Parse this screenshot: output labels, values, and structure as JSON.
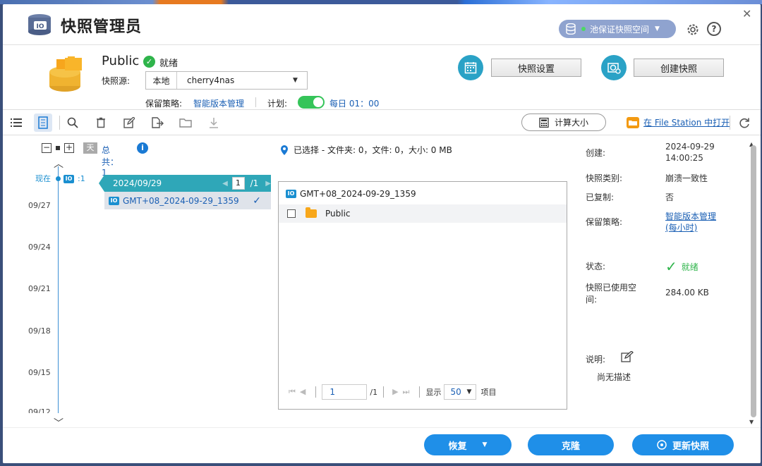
{
  "app": {
    "title": "快照管理员",
    "pool_button": "池保证快照空间",
    "help": "?"
  },
  "header": {
    "share_name": "Public",
    "status": "就绪",
    "source_label": "快照源:",
    "source_location": "本地",
    "source_host": "cherry4nas",
    "retention_label": "保留策略:",
    "retention_value": "智能版本管理",
    "plan_label": "计划:",
    "plan_value": "每日 01：00",
    "plan_enabled": true,
    "snapshot_settings_button": "快照设置",
    "create_snapshot_button": "创建快照"
  },
  "toolbar": {
    "calc_size_button": "计算大小",
    "open_in_fs_link": "在 File Station 中打开"
  },
  "timeline": {
    "day_badge": "天",
    "total_label": "总共：",
    "total_count": "1",
    "now_label": "现在",
    "now_count": ":1",
    "date_ticks": [
      "09/27",
      "09/24",
      "09/21",
      "09/18",
      "09/15",
      "09/12"
    ]
  },
  "snapshots": {
    "date": "2024/09/29",
    "page_current": "1",
    "page_total": "/1",
    "items": [
      {
        "name": "GMT+08_2024-09-29_1359"
      }
    ]
  },
  "selection": {
    "text": "已选择 - 文件夹: 0，文件: 0，大小: 0 MB"
  },
  "file_panel": {
    "path": "GMT+08_2024-09-29_1359",
    "rows": [
      {
        "name": "Public"
      }
    ],
    "page_input": "1",
    "page_total": "/1",
    "show_label": "显示",
    "per_page": "50",
    "items_label": "项目"
  },
  "details": {
    "created_label": "创建:",
    "created_date": "2024-09-29",
    "created_time": "14:00:25",
    "type_label": "快照类别:",
    "type_value": "崩溃一致性",
    "replicated_label": "已复制:",
    "replicated_value": "否",
    "retention_label": "保留策略:",
    "retention_line1": "智能版本管理",
    "retention_line2": "(每小时)",
    "status_label": "状态:",
    "status_value": "就绪",
    "used_label_1": "快照已使用空",
    "used_label_2": "间:",
    "used_value": "284.00 KB",
    "desc_label": "说明:",
    "desc_value": "尚无描述"
  },
  "footer": {
    "restore_button": "恢复",
    "clone_button": "克隆",
    "third_button": "更新快照"
  },
  "colors": {
    "accent": "#1f8fe8",
    "teal": "#2fa7b8",
    "link": "#1a5fb4",
    "ok": "#2fb44b"
  }
}
